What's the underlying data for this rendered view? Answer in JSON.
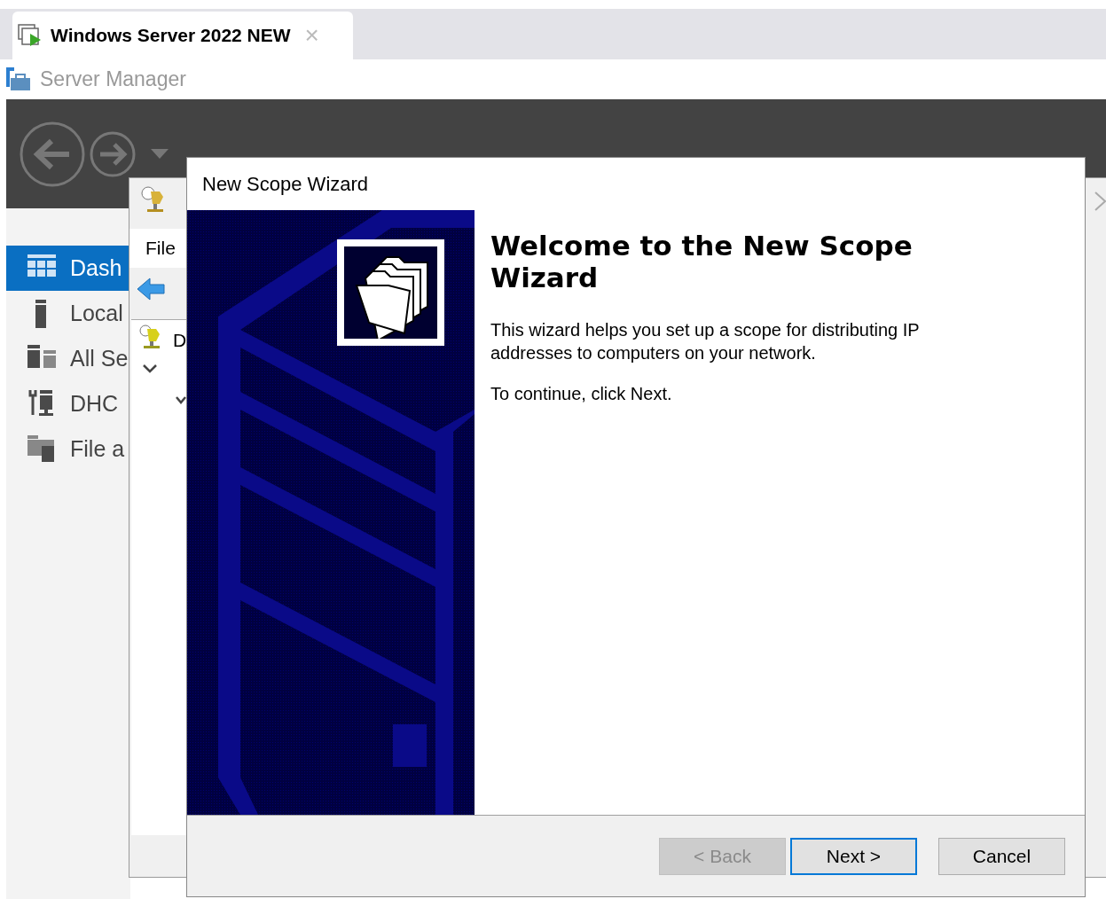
{
  "browser_tab": {
    "title": "Windows Server 2022 NEW",
    "close": "×"
  },
  "app_title": "Server Manager",
  "sidebar": {
    "items": [
      {
        "label": "Dash",
        "kind": "dashboard",
        "selected": true
      },
      {
        "label": "Local",
        "kind": "server",
        "selected": false
      },
      {
        "label": "All Se",
        "kind": "servers",
        "selected": false
      },
      {
        "label": "DHC",
        "kind": "tools",
        "selected": false
      },
      {
        "label": "File a",
        "kind": "files",
        "selected": false
      }
    ]
  },
  "mmc": {
    "menu": [
      "File"
    ],
    "tree_item": "D"
  },
  "wizard": {
    "title": "New Scope Wizard",
    "heading": "Welcome to the New Scope Wizard",
    "paragraphs": [
      "This wizard helps you set up a scope for distributing IP addresses to computers on your network.",
      "To continue, click Next."
    ],
    "buttons": [
      {
        "label": "< Back",
        "disabled": true,
        "default": false
      },
      {
        "label": "Next >",
        "disabled": false,
        "default": true
      },
      {
        "label": "Cancel",
        "disabled": false,
        "default": false
      }
    ]
  }
}
